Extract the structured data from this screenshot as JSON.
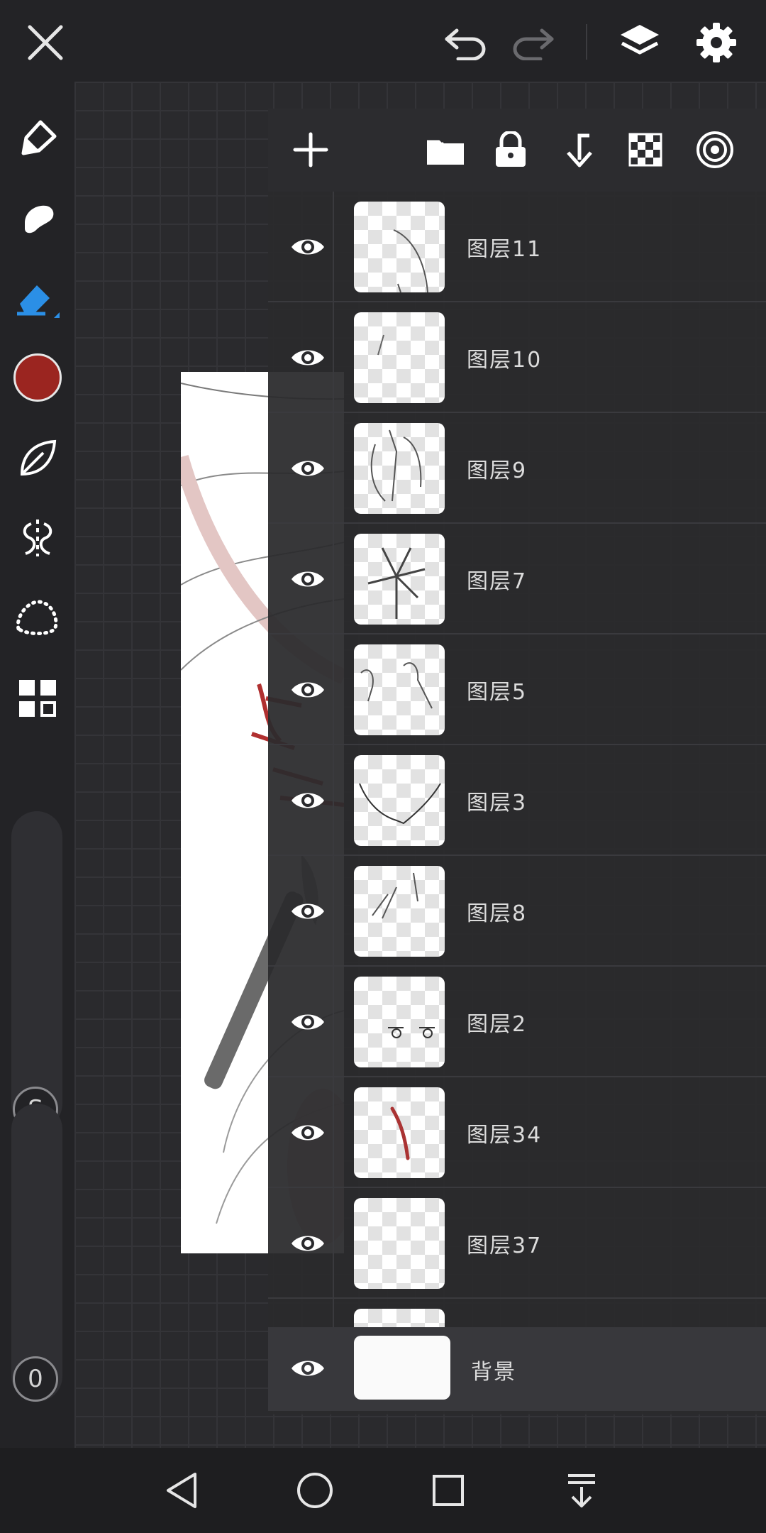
{
  "topbar": {
    "close_icon": "close-icon",
    "undo_icon": "undo-icon",
    "redo_icon": "redo-icon",
    "layers_icon": "layers-icon",
    "settings_icon": "gear-icon"
  },
  "leftbar": {
    "tools": [
      "pen-icon",
      "smudge-icon",
      "eraser-icon",
      "color-swatch",
      "leaf-icon",
      "symmetry-icon",
      "lasso-icon",
      "grid-icon"
    ],
    "active_color": "#9b2520",
    "accent": "#2b8fe6",
    "size_label": "S",
    "opacity_label": "0"
  },
  "layers": {
    "toolbar": [
      "add-layer-icon",
      "folder-icon",
      "lock-icon",
      "merge-down-icon",
      "transparency-icon",
      "blend-mode-icon"
    ],
    "items": [
      {
        "name": "图层11"
      },
      {
        "name": "图层10"
      },
      {
        "name": "图层9"
      },
      {
        "name": "图层7"
      },
      {
        "name": "图层5"
      },
      {
        "name": "图层3"
      },
      {
        "name": "图层8"
      },
      {
        "name": "图层2"
      },
      {
        "name": "图层34"
      },
      {
        "name": "图层37"
      }
    ],
    "background": {
      "name": "背景"
    }
  },
  "navbar": [
    "back-icon",
    "home-icon",
    "recents-icon",
    "menu-down-icon"
  ]
}
